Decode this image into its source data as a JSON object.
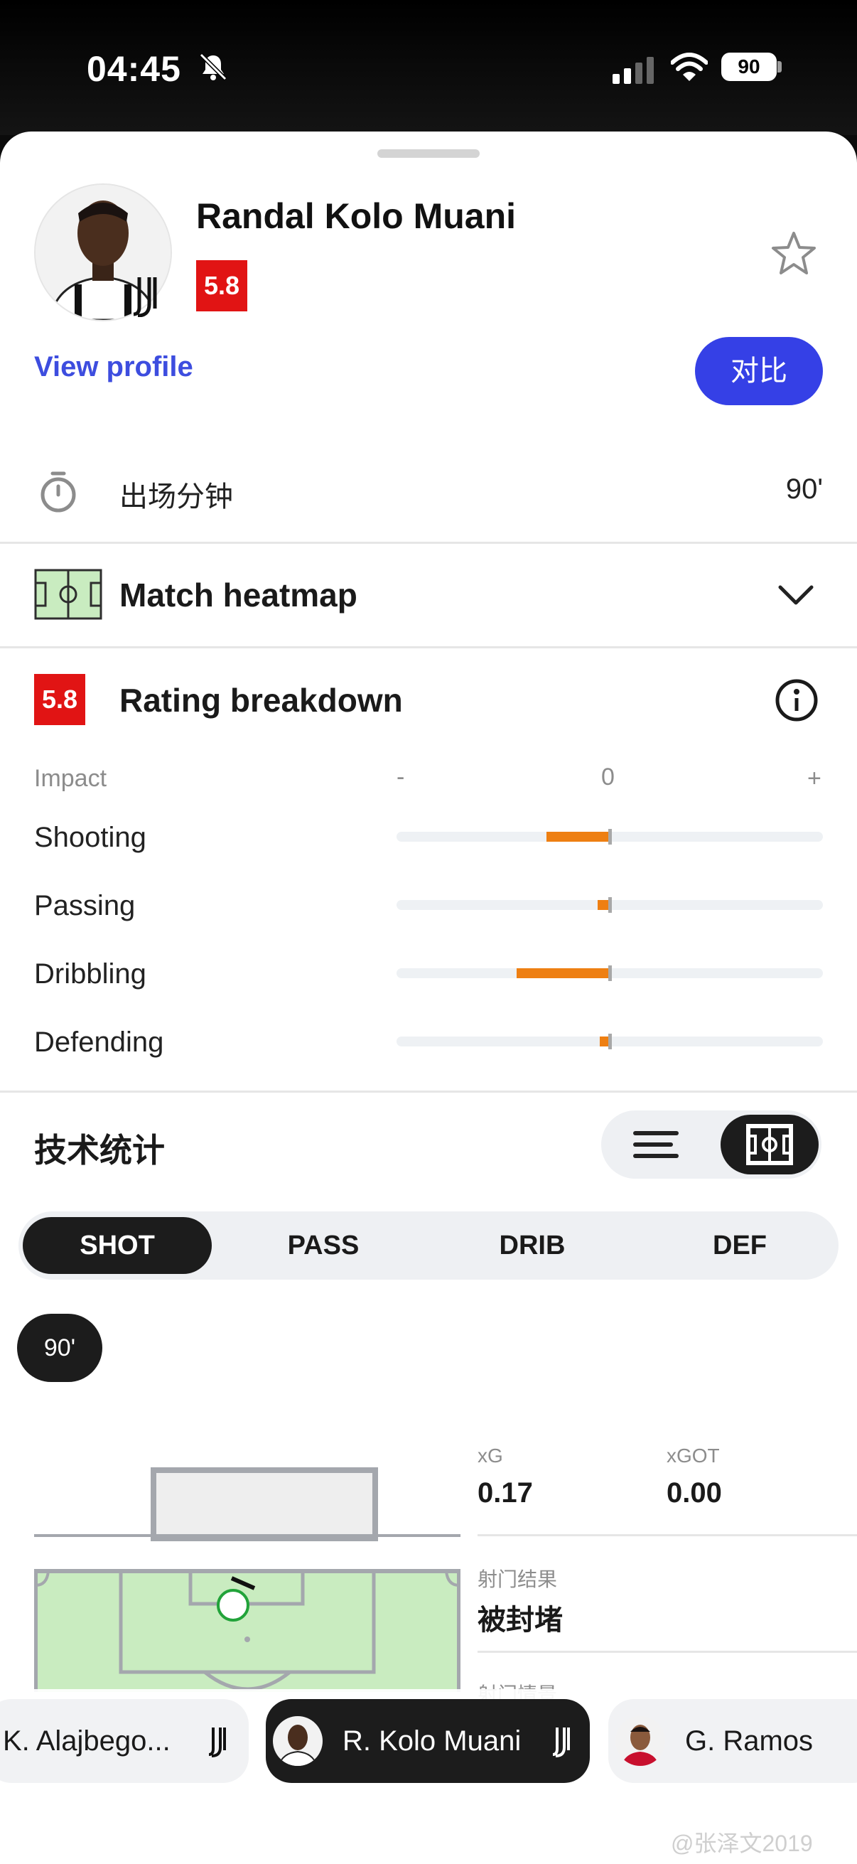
{
  "status_bar": {
    "time": "04:45",
    "battery": "90"
  },
  "player": {
    "name": "Randal Kolo Muani",
    "rating": "5.8",
    "view_profile": "View profile",
    "compare_label": "对比"
  },
  "minutes_row": {
    "label": "出场分钟",
    "value": "90'"
  },
  "heatmap": {
    "title": "Match heatmap"
  },
  "rating_breakdown": {
    "badge": "5.8",
    "title": "Rating breakdown",
    "impact_label": "Impact",
    "scale_minus": "-",
    "scale_zero": "0",
    "scale_plus": "+",
    "rows": [
      {
        "label": "Shooting",
        "impact": -0.29
      },
      {
        "label": "Passing",
        "impact": -0.05
      },
      {
        "label": "Dribbling",
        "impact": -0.43
      },
      {
        "label": "Defending",
        "impact": -0.04
      }
    ]
  },
  "tech_stats": {
    "title": "技术统计",
    "tabs": [
      "SHOT",
      "PASS",
      "DRIB",
      "DEF"
    ],
    "active_tab": "SHOT",
    "minute_chip": "90'",
    "xg_label": "xG",
    "xg_value": "0.17",
    "xgot_label": "xGOT",
    "xgot_value": "0.00",
    "result_label": "射门结果",
    "result_value": "被封堵",
    "next_label": "射门情景"
  },
  "player_switcher": [
    {
      "name": "K. Alajbego...",
      "active": false
    },
    {
      "name": "R. Kolo Muani",
      "active": true
    },
    {
      "name": "G. Ramos",
      "active": false
    }
  ],
  "watermark": "@张泽文2019",
  "colors": {
    "accent": "#3540e6",
    "rating_red": "#e11414",
    "impact_orange": "#ee7f12",
    "pitch_green": "#c9ecc0"
  }
}
